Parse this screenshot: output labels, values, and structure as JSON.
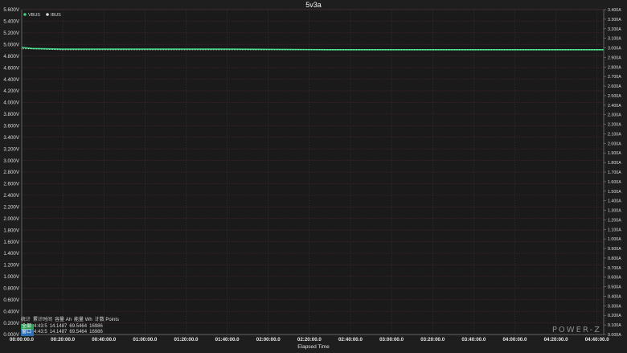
{
  "chart_data": {
    "type": "line",
    "title": "5v3a",
    "xlabel": "Elapsed Time",
    "ylabel_left": "",
    "ylabel_right": "",
    "x_ticks": [
      "00:00:00.0",
      "00:20:00.0",
      "00:40:00.0",
      "01:00:00.0",
      "01:20:00.0",
      "01:40:00.0",
      "02:00:00.0",
      "02:20:00.0",
      "02:40:00.0",
      "03:00:00.0",
      "03:20:00.0",
      "03:40:00.0",
      "04:00:00.0",
      "04:20:00.0",
      "04:40:00.0"
    ],
    "x_range_seconds": [
      0,
      16995
    ],
    "left_axis": {
      "unit": "V",
      "ylim": [
        0,
        5.6
      ],
      "ticks": [
        "0.000V",
        "0.200V",
        "0.400V",
        "0.600V",
        "0.800V",
        "1.000V",
        "1.200V",
        "1.400V",
        "1.600V",
        "1.800V",
        "2.000V",
        "2.200V",
        "2.400V",
        "2.600V",
        "2.800V",
        "3.000V",
        "3.200V",
        "3.400V",
        "3.600V",
        "3.800V",
        "4.000V",
        "4.200V",
        "4.400V",
        "4.600V",
        "4.800V",
        "5.000V",
        "5.200V",
        "5.400V",
        "5.600V"
      ]
    },
    "right_axis": {
      "unit": "A",
      "ylim": [
        0,
        3.4
      ],
      "ticks": [
        "0.000A",
        "0.100A",
        "0.200A",
        "0.300A",
        "0.400A",
        "0.500A",
        "0.600A",
        "0.700A",
        "0.800A",
        "0.900A",
        "1.000A",
        "1.100A",
        "1.200A",
        "1.300A",
        "1.400A",
        "1.500A",
        "1.600A",
        "1.700A",
        "1.800A",
        "1.900A",
        "2.000A",
        "2.100A",
        "2.200A",
        "2.300A",
        "2.400A",
        "2.500A",
        "2.600A",
        "2.700A",
        "2.800A",
        "2.900A",
        "3.000A",
        "3.100A",
        "3.200A",
        "3.300A",
        "3.400A"
      ]
    },
    "series": [
      {
        "name": "VBUS",
        "axis": "left",
        "color": "#3fd07f",
        "x": [
          0,
          300,
          1200,
          3000,
          6000,
          9000,
          12000,
          15000,
          16995
        ],
        "values": [
          4.95,
          4.93,
          4.92,
          4.92,
          4.92,
          4.91,
          4.91,
          4.91,
          4.91
        ]
      },
      {
        "name": "IBUS",
        "axis": "right",
        "color": "#d8d8d8",
        "x": [
          0,
          300,
          1200,
          3000,
          6000,
          9000,
          12000,
          15000,
          16995
        ],
        "values": [
          2.99,
          2.99,
          2.98,
          2.98,
          2.98,
          2.98,
          2.98,
          2.98,
          2.98
        ]
      }
    ],
    "legend": "top-left",
    "grid": true
  },
  "stats": {
    "header": [
      "统计",
      "累计时间",
      "容量 Ah",
      "能量 Wh",
      "计数 Points"
    ],
    "rows": [
      {
        "label": "全部",
        "color": "#2e9d5a",
        "time": "4:43:5",
        "ah": "14.1487",
        "wh": "69.5464",
        "points": "16986"
      },
      {
        "label": "窗口",
        "color": "#2f6fb5",
        "time": "4:43:5",
        "ah": "14.1487",
        "wh": "69.5464",
        "points": "16986"
      }
    ]
  },
  "logo": "POWER-Z"
}
